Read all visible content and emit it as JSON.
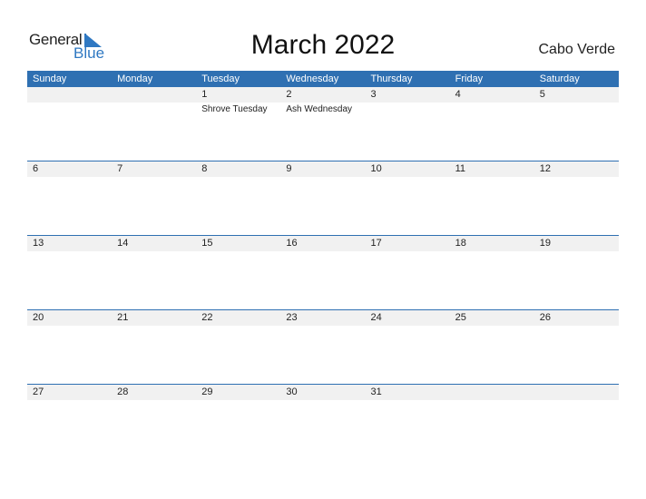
{
  "logo": {
    "word1": "General",
    "word2": "Blue",
    "icon": "triangle-flag-icon"
  },
  "title": "March 2022",
  "country": "Cabo Verde",
  "colors": {
    "accent": "#2f70b2",
    "row_band": "#f1f1f1"
  },
  "weekdays": [
    "Sunday",
    "Monday",
    "Tuesday",
    "Wednesday",
    "Thursday",
    "Friday",
    "Saturday"
  ],
  "weeks": [
    {
      "days": [
        "",
        "",
        "1",
        "2",
        "3",
        "4",
        "5"
      ],
      "events": [
        "",
        "",
        "Shrove Tuesday",
        "Ash Wednesday",
        "",
        "",
        ""
      ]
    },
    {
      "days": [
        "6",
        "7",
        "8",
        "9",
        "10",
        "11",
        "12"
      ],
      "events": [
        "",
        "",
        "",
        "",
        "",
        "",
        ""
      ]
    },
    {
      "days": [
        "13",
        "14",
        "15",
        "16",
        "17",
        "18",
        "19"
      ],
      "events": [
        "",
        "",
        "",
        "",
        "",
        "",
        ""
      ]
    },
    {
      "days": [
        "20",
        "21",
        "22",
        "23",
        "24",
        "25",
        "26"
      ],
      "events": [
        "",
        "",
        "",
        "",
        "",
        "",
        ""
      ]
    },
    {
      "days": [
        "27",
        "28",
        "29",
        "30",
        "31",
        "",
        ""
      ],
      "events": [
        "",
        "",
        "",
        "",
        "",
        "",
        ""
      ]
    }
  ]
}
